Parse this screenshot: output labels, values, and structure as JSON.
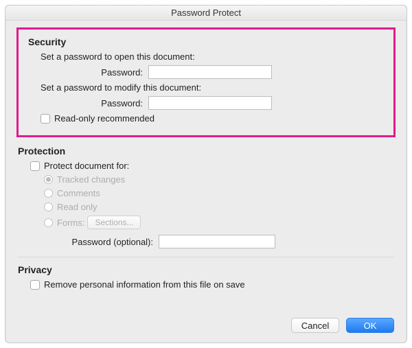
{
  "window": {
    "title": "Password Protect"
  },
  "security": {
    "heading": "Security",
    "open_label": "Set a password to open this document:",
    "password_label": "Password:",
    "open_value": "",
    "modify_label": "Set a password to modify this document:",
    "modify_value": "",
    "readonly_label": "Read-only recommended"
  },
  "protection": {
    "heading": "Protection",
    "protect_for_label": "Protect document for:",
    "tracked": "Tracked changes",
    "comments": "Comments",
    "readonly": "Read only",
    "forms": "Forms:",
    "sections_btn": "Sections...",
    "password_optional_label": "Password (optional):",
    "password_optional_value": ""
  },
  "privacy": {
    "heading": "Privacy",
    "remove_label": "Remove personal information from this file on save"
  },
  "buttons": {
    "cancel": "Cancel",
    "ok": "OK"
  }
}
